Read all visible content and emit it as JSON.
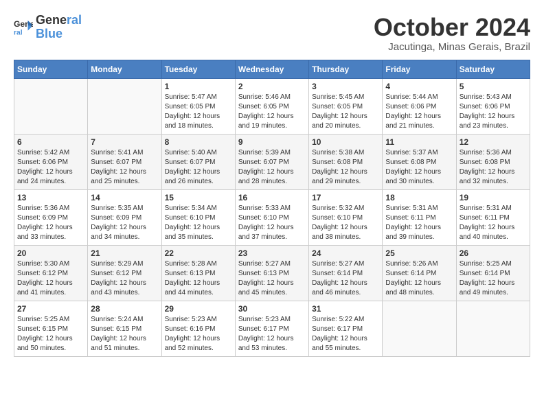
{
  "header": {
    "logo_line1": "General",
    "logo_line2": "Blue",
    "month": "October 2024",
    "location": "Jacutinga, Minas Gerais, Brazil"
  },
  "days_of_week": [
    "Sunday",
    "Monday",
    "Tuesday",
    "Wednesday",
    "Thursday",
    "Friday",
    "Saturday"
  ],
  "weeks": [
    [
      {
        "day": "",
        "sunrise": "",
        "sunset": "",
        "daylight": ""
      },
      {
        "day": "",
        "sunrise": "",
        "sunset": "",
        "daylight": ""
      },
      {
        "day": "1",
        "sunrise": "Sunrise: 5:47 AM",
        "sunset": "Sunset: 6:05 PM",
        "daylight": "Daylight: 12 hours and 18 minutes."
      },
      {
        "day": "2",
        "sunrise": "Sunrise: 5:46 AM",
        "sunset": "Sunset: 6:05 PM",
        "daylight": "Daylight: 12 hours and 19 minutes."
      },
      {
        "day": "3",
        "sunrise": "Sunrise: 5:45 AM",
        "sunset": "Sunset: 6:05 PM",
        "daylight": "Daylight: 12 hours and 20 minutes."
      },
      {
        "day": "4",
        "sunrise": "Sunrise: 5:44 AM",
        "sunset": "Sunset: 6:06 PM",
        "daylight": "Daylight: 12 hours and 21 minutes."
      },
      {
        "day": "5",
        "sunrise": "Sunrise: 5:43 AM",
        "sunset": "Sunset: 6:06 PM",
        "daylight": "Daylight: 12 hours and 23 minutes."
      }
    ],
    [
      {
        "day": "6",
        "sunrise": "Sunrise: 5:42 AM",
        "sunset": "Sunset: 6:06 PM",
        "daylight": "Daylight: 12 hours and 24 minutes."
      },
      {
        "day": "7",
        "sunrise": "Sunrise: 5:41 AM",
        "sunset": "Sunset: 6:07 PM",
        "daylight": "Daylight: 12 hours and 25 minutes."
      },
      {
        "day": "8",
        "sunrise": "Sunrise: 5:40 AM",
        "sunset": "Sunset: 6:07 PM",
        "daylight": "Daylight: 12 hours and 26 minutes."
      },
      {
        "day": "9",
        "sunrise": "Sunrise: 5:39 AM",
        "sunset": "Sunset: 6:07 PM",
        "daylight": "Daylight: 12 hours and 28 minutes."
      },
      {
        "day": "10",
        "sunrise": "Sunrise: 5:38 AM",
        "sunset": "Sunset: 6:08 PM",
        "daylight": "Daylight: 12 hours and 29 minutes."
      },
      {
        "day": "11",
        "sunrise": "Sunrise: 5:37 AM",
        "sunset": "Sunset: 6:08 PM",
        "daylight": "Daylight: 12 hours and 30 minutes."
      },
      {
        "day": "12",
        "sunrise": "Sunrise: 5:36 AM",
        "sunset": "Sunset: 6:08 PM",
        "daylight": "Daylight: 12 hours and 32 minutes."
      }
    ],
    [
      {
        "day": "13",
        "sunrise": "Sunrise: 5:36 AM",
        "sunset": "Sunset: 6:09 PM",
        "daylight": "Daylight: 12 hours and 33 minutes."
      },
      {
        "day": "14",
        "sunrise": "Sunrise: 5:35 AM",
        "sunset": "Sunset: 6:09 PM",
        "daylight": "Daylight: 12 hours and 34 minutes."
      },
      {
        "day": "15",
        "sunrise": "Sunrise: 5:34 AM",
        "sunset": "Sunset: 6:10 PM",
        "daylight": "Daylight: 12 hours and 35 minutes."
      },
      {
        "day": "16",
        "sunrise": "Sunrise: 5:33 AM",
        "sunset": "Sunset: 6:10 PM",
        "daylight": "Daylight: 12 hours and 37 minutes."
      },
      {
        "day": "17",
        "sunrise": "Sunrise: 5:32 AM",
        "sunset": "Sunset: 6:10 PM",
        "daylight": "Daylight: 12 hours and 38 minutes."
      },
      {
        "day": "18",
        "sunrise": "Sunrise: 5:31 AM",
        "sunset": "Sunset: 6:11 PM",
        "daylight": "Daylight: 12 hours and 39 minutes."
      },
      {
        "day": "19",
        "sunrise": "Sunrise: 5:31 AM",
        "sunset": "Sunset: 6:11 PM",
        "daylight": "Daylight: 12 hours and 40 minutes."
      }
    ],
    [
      {
        "day": "20",
        "sunrise": "Sunrise: 5:30 AM",
        "sunset": "Sunset: 6:12 PM",
        "daylight": "Daylight: 12 hours and 41 minutes."
      },
      {
        "day": "21",
        "sunrise": "Sunrise: 5:29 AM",
        "sunset": "Sunset: 6:12 PM",
        "daylight": "Daylight: 12 hours and 43 minutes."
      },
      {
        "day": "22",
        "sunrise": "Sunrise: 5:28 AM",
        "sunset": "Sunset: 6:13 PM",
        "daylight": "Daylight: 12 hours and 44 minutes."
      },
      {
        "day": "23",
        "sunrise": "Sunrise: 5:27 AM",
        "sunset": "Sunset: 6:13 PM",
        "daylight": "Daylight: 12 hours and 45 minutes."
      },
      {
        "day": "24",
        "sunrise": "Sunrise: 5:27 AM",
        "sunset": "Sunset: 6:14 PM",
        "daylight": "Daylight: 12 hours and 46 minutes."
      },
      {
        "day": "25",
        "sunrise": "Sunrise: 5:26 AM",
        "sunset": "Sunset: 6:14 PM",
        "daylight": "Daylight: 12 hours and 48 minutes."
      },
      {
        "day": "26",
        "sunrise": "Sunrise: 5:25 AM",
        "sunset": "Sunset: 6:14 PM",
        "daylight": "Daylight: 12 hours and 49 minutes."
      }
    ],
    [
      {
        "day": "27",
        "sunrise": "Sunrise: 5:25 AM",
        "sunset": "Sunset: 6:15 PM",
        "daylight": "Daylight: 12 hours and 50 minutes."
      },
      {
        "day": "28",
        "sunrise": "Sunrise: 5:24 AM",
        "sunset": "Sunset: 6:15 PM",
        "daylight": "Daylight: 12 hours and 51 minutes."
      },
      {
        "day": "29",
        "sunrise": "Sunrise: 5:23 AM",
        "sunset": "Sunset: 6:16 PM",
        "daylight": "Daylight: 12 hours and 52 minutes."
      },
      {
        "day": "30",
        "sunrise": "Sunrise: 5:23 AM",
        "sunset": "Sunset: 6:17 PM",
        "daylight": "Daylight: 12 hours and 53 minutes."
      },
      {
        "day": "31",
        "sunrise": "Sunrise: 5:22 AM",
        "sunset": "Sunset: 6:17 PM",
        "daylight": "Daylight: 12 hours and 55 minutes."
      },
      {
        "day": "",
        "sunrise": "",
        "sunset": "",
        "daylight": ""
      },
      {
        "day": "",
        "sunrise": "",
        "sunset": "",
        "daylight": ""
      }
    ]
  ]
}
